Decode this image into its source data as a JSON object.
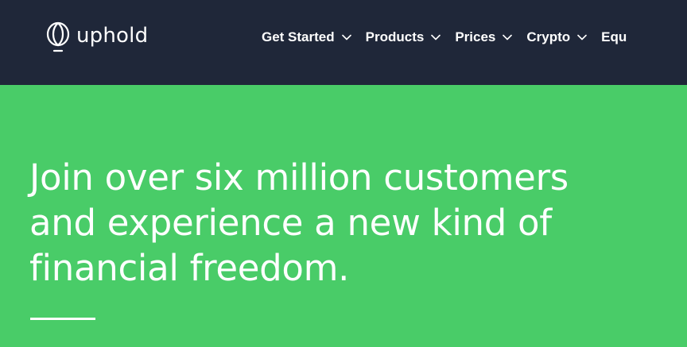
{
  "header": {
    "logo_text": "uphold",
    "logo_icon": "uphold-logo-mark",
    "nav": [
      {
        "label": "Get Started",
        "icon": "chevron-down-icon"
      },
      {
        "label": "Products",
        "icon": "chevron-down-icon"
      },
      {
        "label": "Prices",
        "icon": "chevron-down-icon"
      },
      {
        "label": "Crypto",
        "icon": "chevron-down-icon"
      },
      {
        "label": "Equ"
      }
    ]
  },
  "hero": {
    "headline_lines": [
      "Join over six million customers",
      "and experience a new kind of",
      "financial freedom."
    ]
  },
  "colors": {
    "header_bg": "#1f2739",
    "hero_bg": "#49cc68",
    "text": "#ffffff"
  }
}
